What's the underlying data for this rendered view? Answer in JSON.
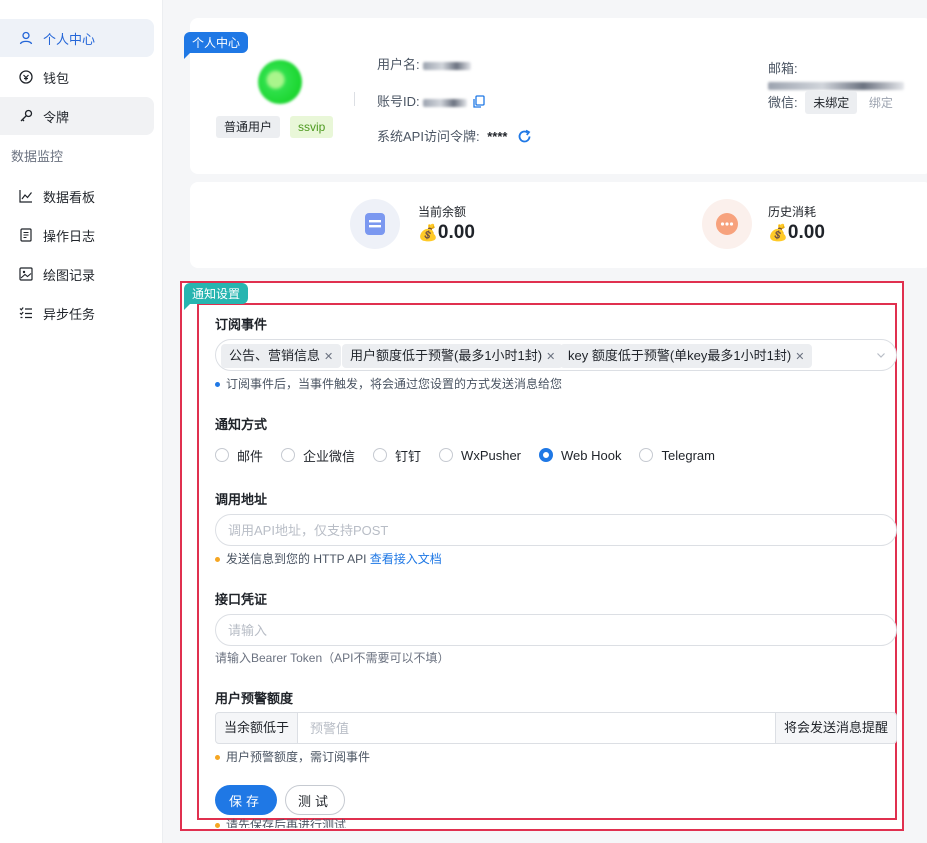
{
  "sidebar": {
    "items": [
      {
        "label": "个人中心",
        "icon": "user-icon"
      },
      {
        "label": "钱包",
        "icon": "wallet-icon"
      },
      {
        "label": "令牌",
        "icon": "key-icon"
      }
    ],
    "group_label": "数据监控",
    "group_items": [
      {
        "label": "数据看板",
        "icon": "line-chart-icon"
      },
      {
        "label": "操作日志",
        "icon": "log-icon"
      },
      {
        "label": "绘图记录",
        "icon": "image-icon"
      },
      {
        "label": "异步任务",
        "icon": "task-list-icon"
      }
    ]
  },
  "profile": {
    "tag": "个人中心",
    "role_badge": "普通用户",
    "level_badge": "ssvip",
    "username_label": "用户名:",
    "account_id_label": "账号ID:",
    "api_token_label": "系统API访问令牌:",
    "api_token_value": "****",
    "email_label": "邮箱:",
    "wechat_label": "微信:",
    "wechat_status": "未绑定",
    "wechat_bind": "绑定"
  },
  "balance": {
    "current_label": "当前余额",
    "current_value": "0.00",
    "history_label": "历史消耗",
    "history_value": "0.00",
    "money_emoji": "💰"
  },
  "notify": {
    "tag": "通知设置",
    "events": {
      "title": "订阅事件",
      "chips": [
        "公告、营销信息",
        "用户额度低于预警(最多1小时1封)",
        "key 额度低于预警(单key最多1小时1封)"
      ],
      "hint": "订阅事件后，当事件触发，将会通过您设置的方式发送消息给您"
    },
    "method": {
      "title": "通知方式",
      "options": [
        "邮件",
        "企业微信",
        "钉钉",
        "WxPusher",
        "Web Hook",
        "Telegram"
      ],
      "selected": "Web Hook"
    },
    "url": {
      "title": "调用地址",
      "placeholder": "调用API地址，仅支持POST",
      "hint_prefix": "发送信息到您的 HTTP API ",
      "hint_link": "查看接入文档"
    },
    "credential": {
      "title": "接口凭证",
      "placeholder": "请输入",
      "hint": "请输入Bearer Token（API不需要可以不填）"
    },
    "threshold": {
      "title": "用户预警额度",
      "prefix": "当余额低于",
      "placeholder": "预警值",
      "suffix": "将会发送消息提醒",
      "hint": "用户预警额度，需订阅事件"
    },
    "buttons": {
      "save": "保存",
      "test": "测试"
    },
    "bottom_hint": "请先保存后再进行测试"
  },
  "colors": {
    "primary": "#1f78e5",
    "teal": "#27b5b0",
    "highlight_border": "#e0304f"
  }
}
